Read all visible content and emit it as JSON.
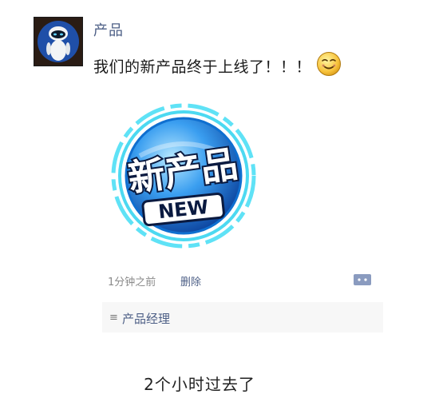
{
  "post": {
    "username": "产品",
    "text": "我们的新产品终于上线了！！！",
    "emoji_icon": "smiling-face-emoji",
    "image": {
      "main_text": "新产品",
      "sub_text": "NEW",
      "colors": {
        "ring": "#1fd0ee",
        "disc": "#2e86e0",
        "badge": "#ffffff"
      }
    },
    "time": "1分钟之前",
    "delete_label": "删除",
    "comment_icon": "comment-bubble-icon"
  },
  "likes": {
    "icon": "≡",
    "names": "产品经理"
  },
  "caption": "2个小时过去了",
  "colors": {
    "link": "#4d5f86",
    "meta": "#8a8a8a",
    "like_bg": "#f7f7f7"
  }
}
